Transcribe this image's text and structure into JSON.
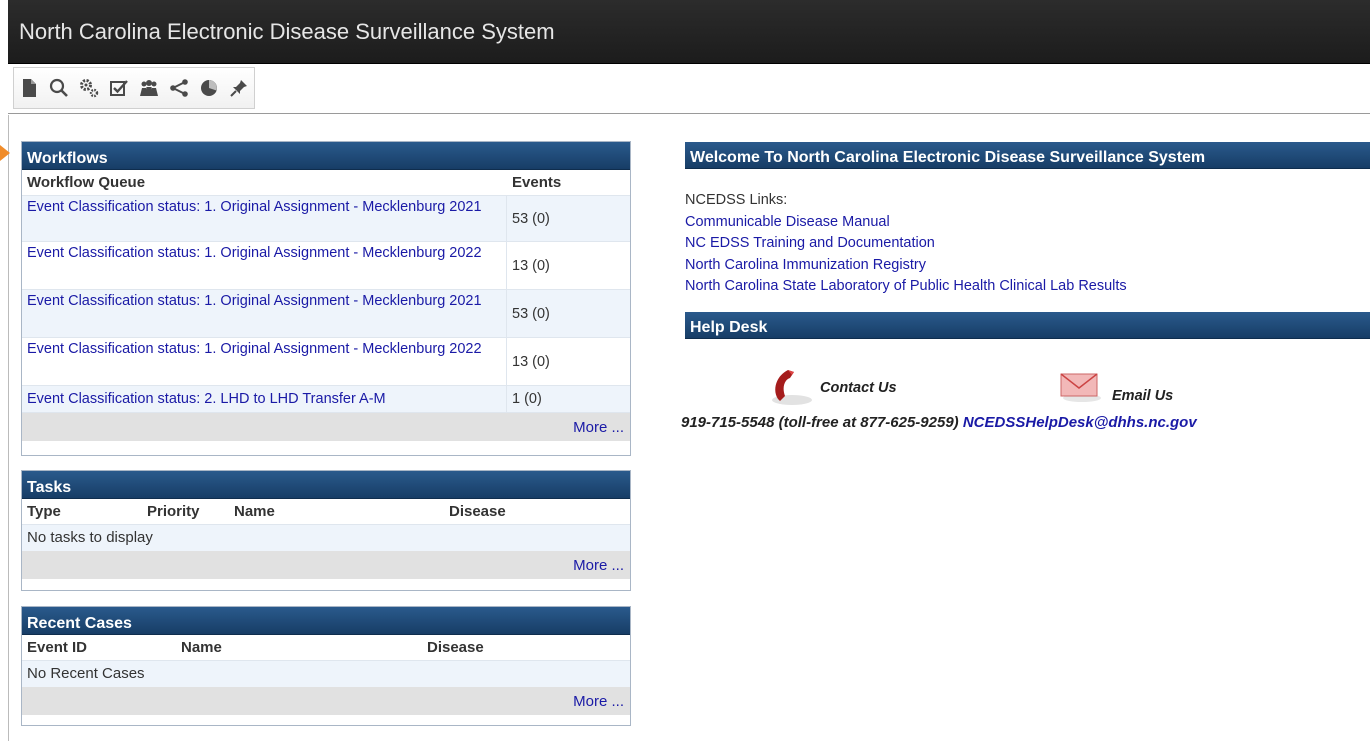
{
  "app": {
    "title": "North Carolina Electronic Disease Surveillance System"
  },
  "toolbar": {
    "icons": [
      "new-document-icon",
      "search-icon",
      "gears-icon",
      "checkbox-icon",
      "people-icon",
      "share-icon",
      "pie-chart-icon",
      "pin-icon"
    ]
  },
  "workflows": {
    "title": "Workflows",
    "col_queue": "Workflow Queue",
    "col_events": "Events",
    "rows": [
      {
        "queue": "Event Classification status: 1. Original Assignment - Mecklenburg 2021",
        "events": "53 (0)"
      },
      {
        "queue": "Event Classification status: 1. Original Assignment - Mecklenburg 2022",
        "events": "13 (0)"
      },
      {
        "queue": "Event Classification status: 1. Original Assignment - Mecklenburg 2021",
        "events": "53 (0)"
      },
      {
        "queue": "Event Classification status: 1. Original Assignment - Mecklenburg 2022",
        "events": "13 (0)"
      },
      {
        "queue": "Event Classification status: 2. LHD to LHD Transfer A-M",
        "events": "1 (0)"
      }
    ],
    "more": "More ..."
  },
  "tasks": {
    "title": "Tasks",
    "col_type": "Type",
    "col_priority": "Priority",
    "col_name": "Name",
    "col_disease": "Disease",
    "empty": "No tasks to display",
    "more": "More ..."
  },
  "recent": {
    "title": "Recent Cases",
    "col_event": "Event ID",
    "col_name": "Name",
    "col_disease": "Disease",
    "empty": "No Recent Cases",
    "more": "More ..."
  },
  "welcome": {
    "title": "Welcome To North Carolina Electronic Disease Surveillance System",
    "links_label": "NCEDSS Links:",
    "links": [
      "Communicable Disease Manual",
      "NC EDSS Training and Documentation",
      "North Carolina Immunization Registry",
      "North Carolina State Laboratory of Public Health Clinical Lab Results"
    ]
  },
  "helpdesk": {
    "title": "Help Desk",
    "contact_label": "Contact Us",
    "email_label": "Email Us",
    "phone": "919-715-5548 (toll-free at 877-625-9259)",
    "email": "NCEDSSHelpDesk@dhhs.nc.gov"
  },
  "colors": {
    "header": "#1e4a78",
    "link": "#1a1aa6",
    "accent": "#f08c2a"
  }
}
